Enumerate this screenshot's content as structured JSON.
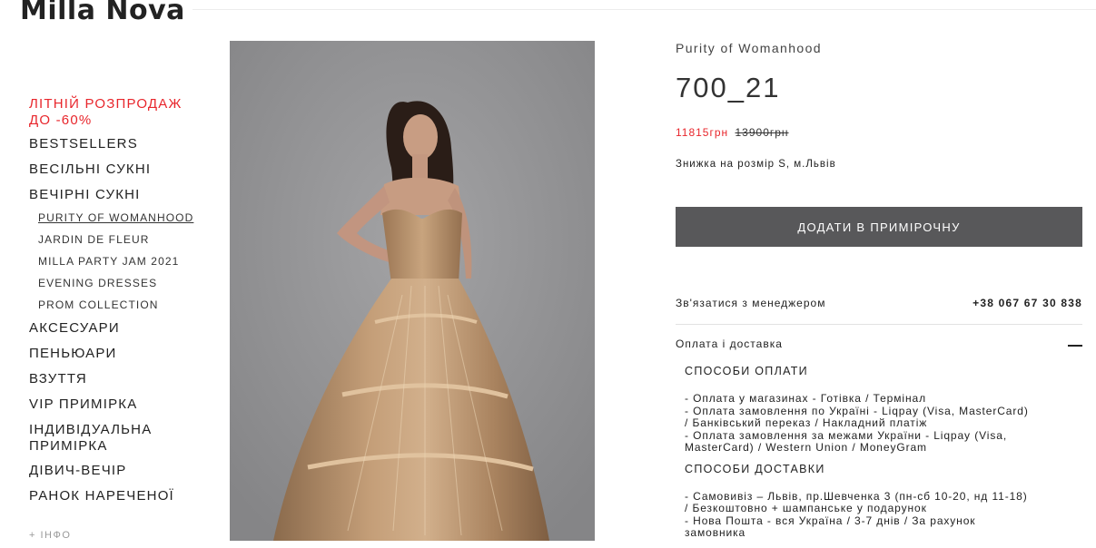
{
  "brand": {
    "logo_text": "Milla Nova"
  },
  "sidebar": {
    "sale": "ЛІТНІЙ РОЗПРОДАЖ ДО -60%",
    "items": [
      {
        "label": "BESTSELLERS"
      },
      {
        "label": "ВЕСІЛЬНІ СУКНІ"
      },
      {
        "label": "ВЕЧІРНІ СУКНІ"
      }
    ],
    "sub_items": [
      {
        "label": "PURITY OF WOMANHOOD"
      },
      {
        "label": "JARDIN DE FLEUR"
      },
      {
        "label": "MILLA PARTY JAM 2021"
      },
      {
        "label": "EVENING DRESSES"
      },
      {
        "label": "PROM COLLECTION"
      }
    ],
    "items_after": [
      {
        "label": "АКСЕСУАРИ"
      },
      {
        "label": "ПЕНЬЮАРИ"
      },
      {
        "label": "ВЗУТТЯ"
      },
      {
        "label": "VIP ПРИМІРКА"
      },
      {
        "label": "ІНДИВІДУАЛЬНА ПРИМІРКА"
      },
      {
        "label": "ДІВИЧ-ВЕЧІР"
      },
      {
        "label": "РАНОК НАРЕЧЕНОЇ"
      }
    ],
    "info": "+ ІНФО"
  },
  "product": {
    "collection": "Purity of Womanhood",
    "model": "700_21",
    "price_new": "11815грн",
    "price_old": "13900грн",
    "discount_note": "Знижка на розмір S, м.Львів",
    "add_button": "ДОДАТИ В ПРИМІРОЧНУ",
    "contact_label": "Зв'язатися з менеджером",
    "phone": "+38 067 67 30 838"
  },
  "accordion": {
    "title": "Оплата і доставка",
    "payment_title": "СПОСОБИ ОПЛАТИ",
    "payment_text": "- Оплата у магазинах - Готівка / Термінал\n- Оплата замовлення по Україні - Liqpay (Visa, MasterCard)\n/ Банківський переказ / Накладний платіж\n- Оплата замовлення за межами України - Liqpay (Visa,\nMasterCard)  / Western Union / MoneyGram",
    "delivery_title": "СПОСОБИ ДОСТАВКИ",
    "delivery_text": "- Самовивіз – Львів, пр.Шевченка 3 (пн-сб 10-20, нд 11-18)\n/ Безкоштовно + шампанське у подарунок\n- Нова Пошта - вся Україна / 3-7 днів / За рахунок\nзамовника"
  },
  "colors": {
    "sale_red": "#e8262c",
    "button_gray": "#58585a",
    "photo_bg": "#9a9a9c",
    "dress_gold": "#b08b64"
  }
}
